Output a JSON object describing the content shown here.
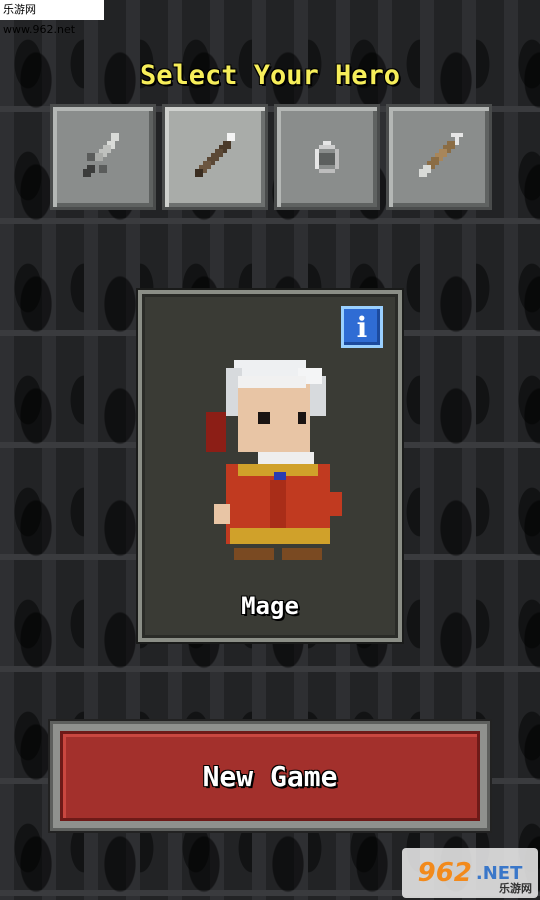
{
  "watermark_top": "乐游网 www.962.net",
  "title": "Select Your Hero",
  "hero_classes": [
    {
      "icon": "sword-icon",
      "selected": false
    },
    {
      "icon": "staff-icon",
      "selected": true
    },
    {
      "icon": "ring-icon",
      "selected": false
    },
    {
      "icon": "bow-icon",
      "selected": false
    }
  ],
  "info_label": "i",
  "hero": {
    "name": "Mage"
  },
  "new_game_label": "New Game",
  "watermark_logo": {
    "num": "962",
    "net": ".NET",
    "cn": "乐游网"
  }
}
